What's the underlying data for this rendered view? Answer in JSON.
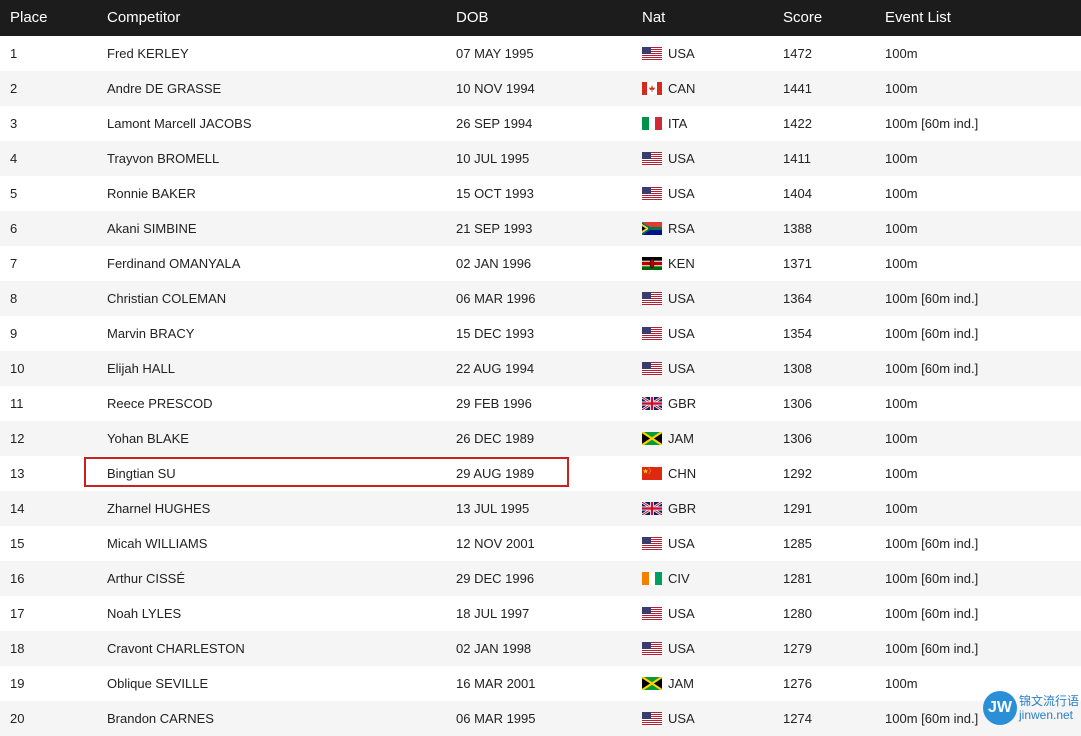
{
  "header": {
    "place": "Place",
    "competitor": "Competitor",
    "dob": "DOB",
    "nat": "Nat",
    "score": "Score",
    "event_list": "Event List"
  },
  "rows": [
    {
      "place": "1",
      "competitor": "Fred KERLEY",
      "dob": "07 MAY 1995",
      "nat": "USA",
      "flag": "usa-flag-icon",
      "score": "1472",
      "event": "100m"
    },
    {
      "place": "2",
      "competitor": "Andre DE GRASSE",
      "dob": "10 NOV 1994",
      "nat": "CAN",
      "flag": "canada-flag-icon",
      "score": "1441",
      "event": "100m"
    },
    {
      "place": "3",
      "competitor": "Lamont Marcell JACOBS",
      "dob": "26 SEP 1994",
      "nat": "ITA",
      "flag": "italy-flag-icon",
      "score": "1422",
      "event": "100m [60m ind.]"
    },
    {
      "place": "4",
      "competitor": "Trayvon BROMELL",
      "dob": "10 JUL 1995",
      "nat": "USA",
      "flag": "usa-flag-icon",
      "score": "1411",
      "event": "100m"
    },
    {
      "place": "5",
      "competitor": "Ronnie BAKER",
      "dob": "15 OCT 1993",
      "nat": "USA",
      "flag": "usa-flag-icon",
      "score": "1404",
      "event": "100m"
    },
    {
      "place": "6",
      "competitor": "Akani SIMBINE",
      "dob": "21 SEP 1993",
      "nat": "RSA",
      "flag": "south-africa-flag-icon",
      "score": "1388",
      "event": "100m"
    },
    {
      "place": "7",
      "competitor": "Ferdinand OMANYALA",
      "dob": "02 JAN 1996",
      "nat": "KEN",
      "flag": "kenya-flag-icon",
      "score": "1371",
      "event": "100m"
    },
    {
      "place": "8",
      "competitor": "Christian COLEMAN",
      "dob": "06 MAR 1996",
      "nat": "USA",
      "flag": "usa-flag-icon",
      "score": "1364",
      "event": "100m [60m ind.]"
    },
    {
      "place": "9",
      "competitor": "Marvin BRACY",
      "dob": "15 DEC 1993",
      "nat": "USA",
      "flag": "usa-flag-icon",
      "score": "1354",
      "event": "100m [60m ind.]"
    },
    {
      "place": "10",
      "competitor": "Elijah HALL",
      "dob": "22 AUG 1994",
      "nat": "USA",
      "flag": "usa-flag-icon",
      "score": "1308",
      "event": "100m [60m ind.]"
    },
    {
      "place": "11",
      "competitor": "Reece PRESCOD",
      "dob": "29 FEB 1996",
      "nat": "GBR",
      "flag": "uk-flag-icon",
      "score": "1306",
      "event": "100m"
    },
    {
      "place": "12",
      "competitor": "Yohan BLAKE",
      "dob": "26 DEC 1989",
      "nat": "JAM",
      "flag": "jamaica-flag-icon",
      "score": "1306",
      "event": "100m"
    },
    {
      "place": "13",
      "competitor": "Bingtian SU",
      "dob": "29 AUG 1989",
      "nat": "CHN",
      "flag": "china-flag-icon",
      "score": "1292",
      "event": "100m"
    },
    {
      "place": "14",
      "competitor": "Zharnel HUGHES",
      "dob": "13 JUL 1995",
      "nat": "GBR",
      "flag": "uk-flag-icon",
      "score": "1291",
      "event": "100m"
    },
    {
      "place": "15",
      "competitor": "Micah WILLIAMS",
      "dob": "12 NOV 2001",
      "nat": "USA",
      "flag": "usa-flag-icon",
      "score": "1285",
      "event": "100m [60m ind.]"
    },
    {
      "place": "16",
      "competitor": "Arthur CISSÉ",
      "dob": "29 DEC 1996",
      "nat": "CIV",
      "flag": "ivory-coast-flag-icon",
      "score": "1281",
      "event": "100m [60m ind.]"
    },
    {
      "place": "17",
      "competitor": "Noah LYLES",
      "dob": "18 JUL 1997",
      "nat": "USA",
      "flag": "usa-flag-icon",
      "score": "1280",
      "event": "100m [60m ind.]"
    },
    {
      "place": "18",
      "competitor": "Cravont CHARLESTON",
      "dob": "02 JAN 1998",
      "nat": "USA",
      "flag": "usa-flag-icon",
      "score": "1279",
      "event": "100m [60m ind.]"
    },
    {
      "place": "19",
      "competitor": "Oblique SEVILLE",
      "dob": "16 MAR 2001",
      "nat": "JAM",
      "flag": "jamaica-flag-icon",
      "score": "1276",
      "event": "100m"
    },
    {
      "place": "20",
      "competitor": "Brandon CARNES",
      "dob": "06 MAR 1995",
      "nat": "USA",
      "flag": "usa-flag-icon",
      "score": "1274",
      "event": "100m [60m ind.]"
    }
  ],
  "highlight": {
    "color": "#cc1f1f",
    "place": "13"
  },
  "watermark": {
    "logo": "JW",
    "line1": "锦文流行语",
    "line2": "jinwen.net"
  }
}
